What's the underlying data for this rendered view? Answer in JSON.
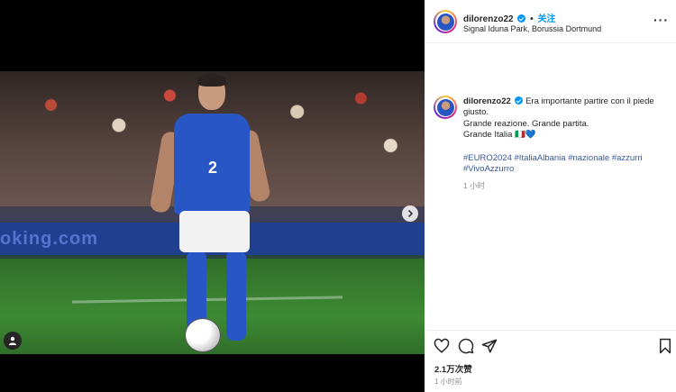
{
  "header": {
    "username": "dilorenzo22",
    "separator": "•",
    "follow_label": "关注",
    "location": "Signal Iduna Park, Borussia Dortmund",
    "more_label": "···"
  },
  "caption": {
    "username": "dilorenzo22",
    "lines": [
      "Era importante partire con il piede",
      "giusto.",
      "Grande reazione. Grande partita.",
      "Grande Italia 🇮🇹💙"
    ],
    "hashtags": [
      "#EURO2024",
      "#ItaliaAlbania",
      "#nazionale",
      "#azzurri",
      "#VivoAzzurro"
    ],
    "time": "1 小时"
  },
  "media": {
    "ad_text": "oking.com",
    "shirt_number": "2",
    "next_icon": "chevron-right-icon",
    "tag_icon": "user-tag-icon"
  },
  "footer": {
    "likes": "2.1万次赞",
    "posted": "1 小时前"
  },
  "colors": {
    "accent": "#0095f6",
    "hashtag": "#385898",
    "jersey": "#2856c5"
  }
}
